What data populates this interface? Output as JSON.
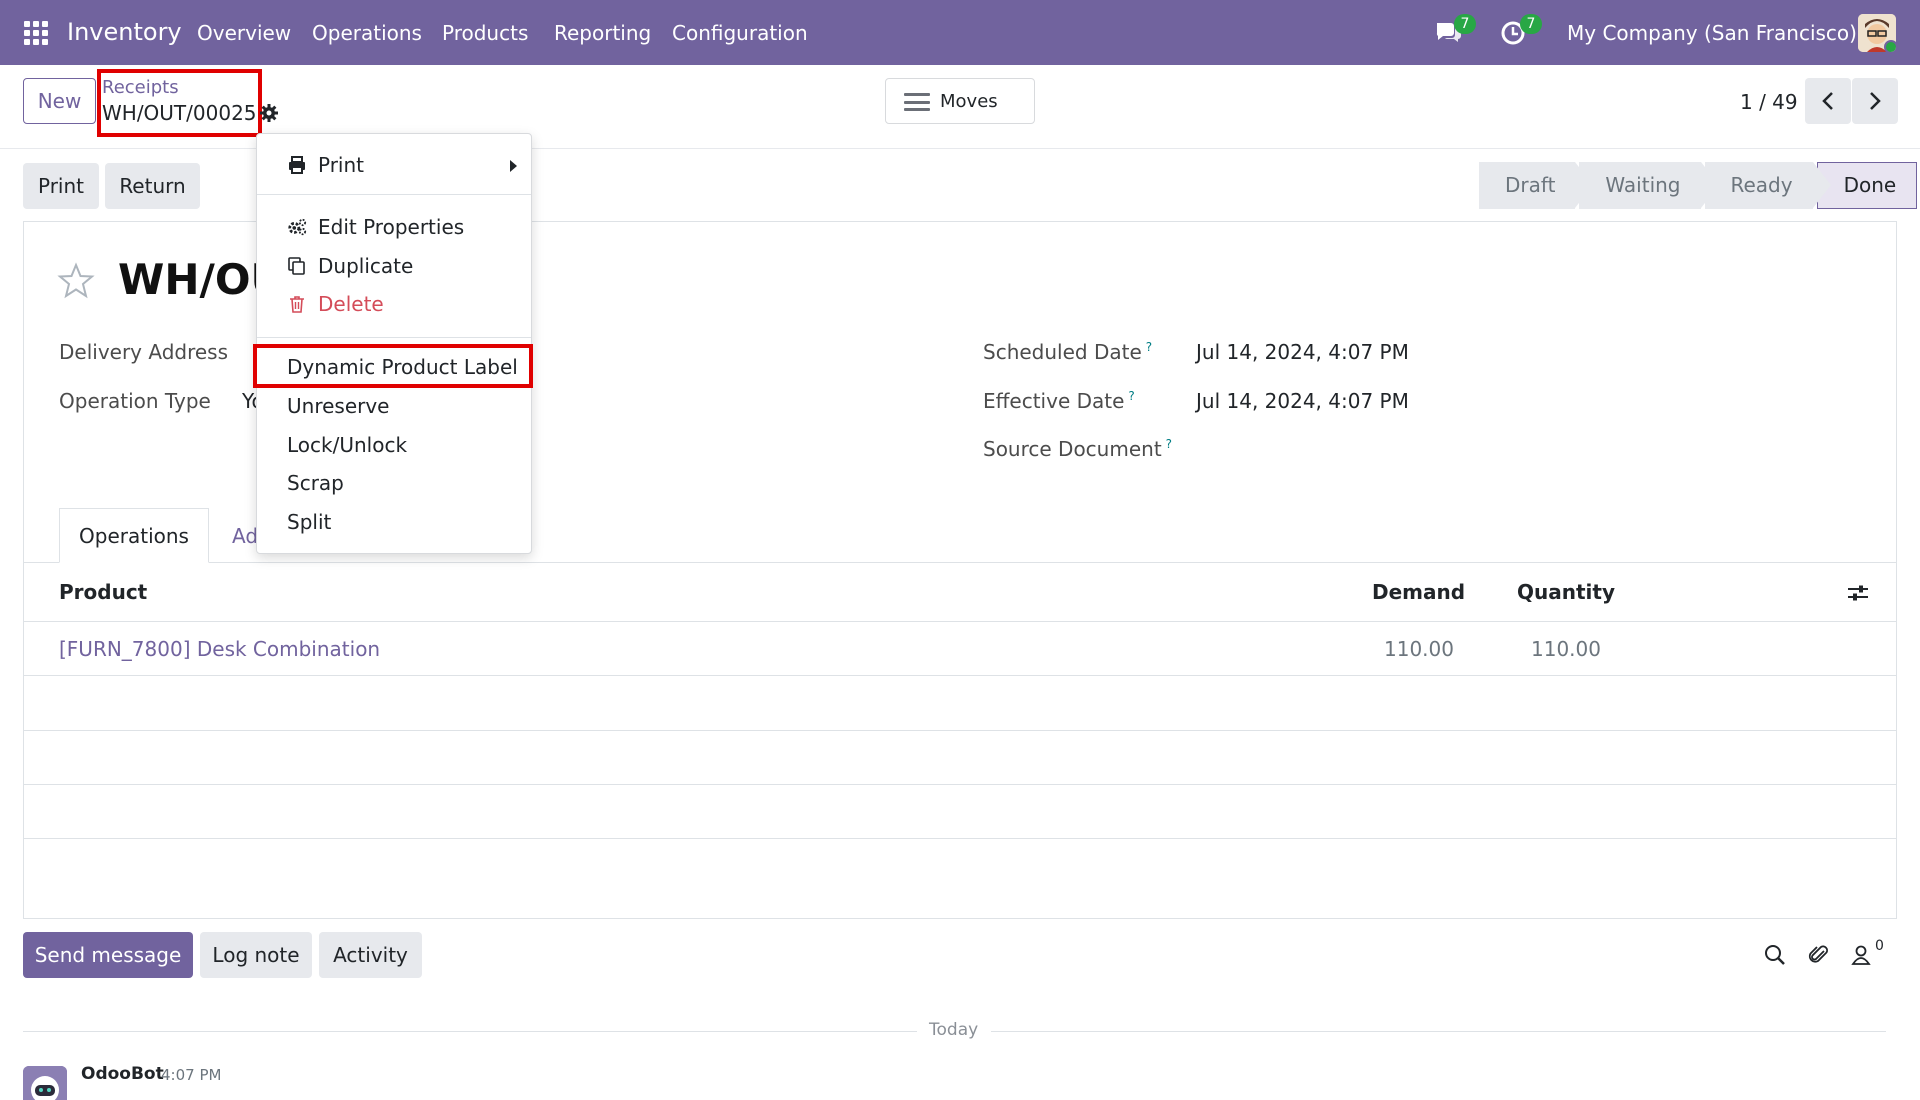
{
  "navbar": {
    "app_name": "Inventory",
    "menu": [
      "Overview",
      "Operations",
      "Products",
      "Reporting",
      "Configuration"
    ],
    "messages_count": "7",
    "activities_count": "7",
    "company": "My Company (San Francisco)",
    "color": "#71639e"
  },
  "control_panel": {
    "new_label": "New",
    "breadcrumb_parent": "Receipts",
    "breadcrumb_current": "WH/OUT/00025",
    "moves_label": "Moves",
    "pager": "1 / 49"
  },
  "actions": {
    "print_label": "Print",
    "return_label": "Return"
  },
  "statusbar": {
    "stages": [
      "Draft",
      "Waiting",
      "Ready",
      "Done"
    ],
    "active": "Done"
  },
  "record": {
    "title": "WH/OU",
    "fields_left": [
      {
        "label": "Delivery Address",
        "value": ""
      },
      {
        "label": "Operation Type",
        "value": "Yo"
      }
    ],
    "fields_right": [
      {
        "label": "Scheduled Date",
        "help": "?",
        "value": "Jul 14, 2024, 4:07 PM"
      },
      {
        "label": "Effective Date",
        "help": "?",
        "value": "Jul 14, 2024, 4:07 PM"
      },
      {
        "label": "Source Document",
        "help": "?",
        "value": ""
      }
    ],
    "tabs": [
      "Operations",
      "Ad"
    ]
  },
  "table": {
    "columns": [
      "Product",
      "Demand",
      "Quantity"
    ],
    "rows": [
      {
        "product": "[FURN_7800] Desk Combination",
        "demand": "110.00",
        "quantity": "110.00"
      }
    ]
  },
  "dropdown": {
    "print_label": "Print",
    "edit_properties_label": "Edit Properties",
    "duplicate_label": "Duplicate",
    "delete_label": "Delete",
    "items": [
      "Dynamic Product Label",
      "Unreserve",
      "Lock/Unlock",
      "Scrap",
      "Split"
    ],
    "delete_color": "#d44c59"
  },
  "chatter": {
    "send_message_label": "Send message",
    "log_note_label": "Log note",
    "activity_label": "Activity",
    "followers_count": "0",
    "today_label": "Today",
    "author": "OdooBot",
    "time": "4:07 PM"
  }
}
